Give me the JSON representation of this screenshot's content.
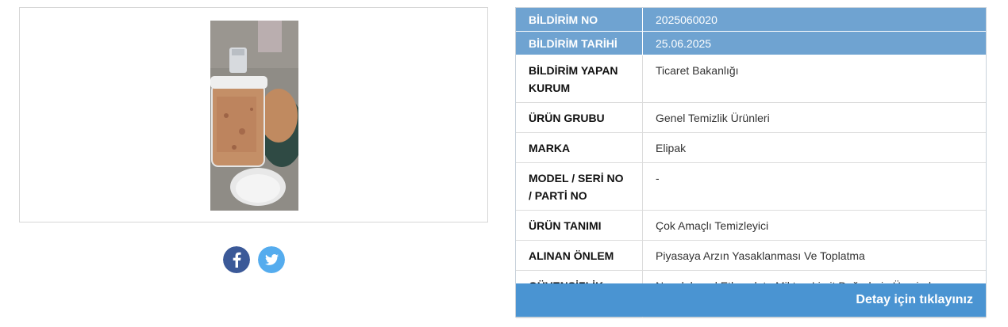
{
  "product_image": {
    "description_icon": "product-photo"
  },
  "social": {
    "facebook_icon": "facebook-icon",
    "twitter_icon": "twitter-icon",
    "facebook_color": "#3b5998",
    "twitter_color": "#55acee"
  },
  "info": {
    "rows": [
      {
        "key": "BİLDİRİM NO",
        "value": "2025060020"
      },
      {
        "key": "BİLDİRİM TARİHİ",
        "value": "25.06.2025"
      },
      {
        "key": "BİLDİRİM YAPAN KURUM",
        "value": "Ticaret Bakanlığı"
      },
      {
        "key": "ÜRÜN GRUBU",
        "value": "Genel Temizlik Ürünleri"
      },
      {
        "key": "MARKA",
        "value": "Elipak"
      },
      {
        "key": "MODEL / SERİ NO / PARTİ NO",
        "value": "-"
      },
      {
        "key": "ÜRÜN TANIMI",
        "value": "Çok Amaçlı Temizleyici"
      },
      {
        "key": "ALINAN ÖNLEM",
        "value": "Piyasaya Arzın Yasaklanması Ve Toplatma"
      },
      {
        "key": "GÜVENSİZLİK NEDENİ",
        "value": "Nonylphenol Ethoxylate Miktarı Limit Değerlerin Üzerinde Çıkmıştır."
      }
    ],
    "detail_link": "Detay için tıklayınız"
  },
  "colors": {
    "header_row": "#6fa3d1",
    "detail_bar": "#4a94d2"
  }
}
